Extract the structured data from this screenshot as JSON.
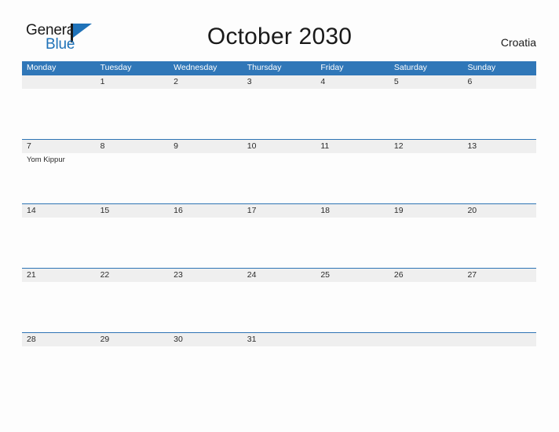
{
  "logo": {
    "text_primary": "General",
    "text_secondary": "Blue",
    "primary_color": "#1a1a1a",
    "accent_color": "#1f72b8"
  },
  "header": {
    "title": "October 2030",
    "region": "Croatia"
  },
  "calendar": {
    "month": "October",
    "year": "2030",
    "header_bg_color": "#3077b8",
    "date_band_color": "#efefef",
    "grid_line_color": "#2e74b5",
    "weekdays": [
      "Monday",
      "Tuesday",
      "Wednesday",
      "Thursday",
      "Friday",
      "Saturday",
      "Sunday"
    ],
    "weeks": [
      {
        "days": [
          {
            "date": "",
            "events": []
          },
          {
            "date": "1",
            "events": []
          },
          {
            "date": "2",
            "events": []
          },
          {
            "date": "3",
            "events": []
          },
          {
            "date": "4",
            "events": []
          },
          {
            "date": "5",
            "events": []
          },
          {
            "date": "6",
            "events": []
          }
        ]
      },
      {
        "days": [
          {
            "date": "7",
            "events": [
              "Yom Kippur"
            ]
          },
          {
            "date": "8",
            "events": []
          },
          {
            "date": "9",
            "events": []
          },
          {
            "date": "10",
            "events": []
          },
          {
            "date": "11",
            "events": []
          },
          {
            "date": "12",
            "events": []
          },
          {
            "date": "13",
            "events": []
          }
        ]
      },
      {
        "days": [
          {
            "date": "14",
            "events": []
          },
          {
            "date": "15",
            "events": []
          },
          {
            "date": "16",
            "events": []
          },
          {
            "date": "17",
            "events": []
          },
          {
            "date": "18",
            "events": []
          },
          {
            "date": "19",
            "events": []
          },
          {
            "date": "20",
            "events": []
          }
        ]
      },
      {
        "days": [
          {
            "date": "21",
            "events": []
          },
          {
            "date": "22",
            "events": []
          },
          {
            "date": "23",
            "events": []
          },
          {
            "date": "24",
            "events": []
          },
          {
            "date": "25",
            "events": []
          },
          {
            "date": "26",
            "events": []
          },
          {
            "date": "27",
            "events": []
          }
        ]
      },
      {
        "days": [
          {
            "date": "28",
            "events": []
          },
          {
            "date": "29",
            "events": []
          },
          {
            "date": "30",
            "events": []
          },
          {
            "date": "31",
            "events": []
          },
          {
            "date": "",
            "events": []
          },
          {
            "date": "",
            "events": []
          },
          {
            "date": "",
            "events": []
          }
        ]
      }
    ]
  }
}
